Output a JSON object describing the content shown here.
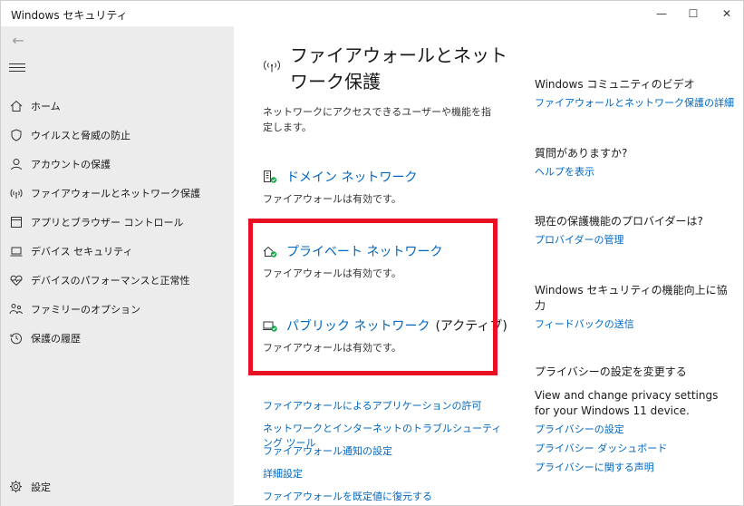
{
  "window": {
    "title": "Windows セキュリティ",
    "minimize": "—",
    "maximize": "☐",
    "close": "✕"
  },
  "sidebar": {
    "back_icon": "←",
    "items": [
      {
        "label": "ホーム",
        "icon": "home-icon"
      },
      {
        "label": "ウイルスと脅威の防止",
        "icon": "shield-icon"
      },
      {
        "label": "アカウントの保護",
        "icon": "person-icon"
      },
      {
        "label": "ファイアウォールとネットワーク保護",
        "icon": "antenna-icon"
      },
      {
        "label": "アプリとブラウザー コントロール",
        "icon": "app-window-icon"
      },
      {
        "label": "デバイス セキュリティ",
        "icon": "laptop-icon"
      },
      {
        "label": "デバイスのパフォーマンスと正常性",
        "icon": "heart-icon"
      },
      {
        "label": "ファミリーのオプション",
        "icon": "family-icon"
      },
      {
        "label": "保護の履歴",
        "icon": "history-icon"
      }
    ],
    "settings_label": "設定"
  },
  "main": {
    "title": "ファイアウォールとネットワーク保護",
    "description": "ネットワークにアクセスできるユーザーや機能を指定します。",
    "networks": [
      {
        "name": "ドメイン ネットワーク",
        "suffix": "",
        "status": "ファイアウォールは有効です。",
        "icon": "domain-network-icon"
      },
      {
        "name": "プライベート ネットワーク",
        "suffix": "",
        "status": "ファイアウォールは有効です。",
        "icon": "private-network-icon"
      },
      {
        "name": "パブリック ネットワーク",
        "suffix": "(アクティブ)",
        "status": "ファイアウォールは有効です。",
        "icon": "public-network-icon"
      }
    ],
    "links": [
      "ファイアウォールによるアプリケーションの許可",
      "ネットワークとインターネットのトラブルシューティング ツール",
      "ファイアウォール通知の設定",
      "詳細設定",
      "ファイアウォールを既定値に復元する"
    ]
  },
  "right": {
    "community": {
      "heading": "Windows コミュニティのビデオ",
      "link": "ファイアウォールとネットワーク保護の詳細"
    },
    "help": {
      "heading": "質問がありますか?",
      "link": "ヘルプを表示"
    },
    "provider": {
      "heading": "現在の保護機能のプロバイダーは?",
      "link": "プロバイダーの管理"
    },
    "feedback": {
      "heading": "Windows セキュリティの機能向上に協力",
      "link": "フィードバックの送信"
    },
    "privacy": {
      "heading": "プライバシーの設定を変更する",
      "text": "View and change privacy settings for your Windows 11 device.",
      "links": [
        "プライバシーの設定",
        "プライバシー ダッシュボード",
        "プライバシーに関する声明"
      ]
    }
  },
  "colors": {
    "accent": "#0067c0",
    "highlight": "#e81123",
    "sidebar_bg": "#ececec",
    "status_ok": "#16a34a"
  }
}
